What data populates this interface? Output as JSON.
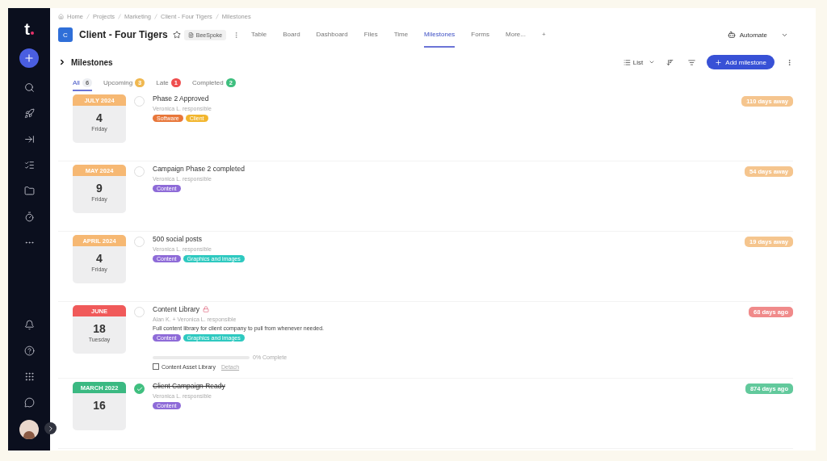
{
  "logo": "t",
  "breadcrumb": [
    "Home",
    "Projects",
    "Marketing",
    "Client - Four Tigers",
    "Milestones"
  ],
  "project": {
    "initial": "C",
    "title": "Client - Four Tigers",
    "starred": false,
    "tag": "BeeSpoke"
  },
  "view_tabs": [
    {
      "label": "Table",
      "selected": false
    },
    {
      "label": "Board",
      "selected": false
    },
    {
      "label": "Dashboard",
      "selected": false
    },
    {
      "label": "Files",
      "selected": false
    },
    {
      "label": "Time",
      "selected": false
    },
    {
      "label": "Milestones",
      "selected": true
    },
    {
      "label": "Forms",
      "selected": false
    },
    {
      "label": "More...",
      "selected": false
    }
  ],
  "add_tab": "+",
  "automate": "Automate",
  "section": {
    "title": "Milestones",
    "view": "List",
    "add_button": "Add milestone"
  },
  "filters": [
    {
      "label": "All",
      "count": "6",
      "kind": "all",
      "selected": true
    },
    {
      "label": "Upcoming",
      "count": "3",
      "kind": "upcoming",
      "selected": false
    },
    {
      "label": "Late",
      "count": "1",
      "kind": "late",
      "selected": false
    },
    {
      "label": "Completed",
      "count": "2",
      "kind": "done",
      "selected": false
    }
  ],
  "milestones": [
    {
      "kind": "upcoming",
      "month": "JULY 2024",
      "day": "4",
      "weekday": "Friday",
      "checked": false,
      "title": "Phase 2 Approved",
      "locked": false,
      "responsible": "Veronica L. responsible",
      "tags": [
        {
          "label": "Software",
          "color": "#e8773a"
        },
        {
          "label": "Client",
          "color": "#f2b62e"
        }
      ],
      "due": "110 days away"
    },
    {
      "kind": "upcoming",
      "month": "MAY 2024",
      "day": "9",
      "weekday": "Friday",
      "checked": false,
      "title": "Campaign Phase 2 completed",
      "locked": false,
      "responsible": "Veronica L. responsible",
      "tags": [
        {
          "label": "Content",
          "color": "#8e6bd8"
        }
      ],
      "due": "54 days away"
    },
    {
      "kind": "upcoming",
      "month": "APRIL 2024",
      "day": "4",
      "weekday": "Friday",
      "checked": false,
      "title": "500 social posts",
      "locked": false,
      "responsible": "Veronica L. responsible",
      "tags": [
        {
          "label": "Content",
          "color": "#8e6bd8"
        },
        {
          "label": "Graphics and images",
          "color": "#2ec9c0"
        }
      ],
      "due": "19 days away"
    },
    {
      "kind": "late",
      "month": "JUNE",
      "day": "18",
      "weekday": "Tuesday",
      "checked": false,
      "title": "Content Library",
      "locked": true,
      "responsible": "Alan K. + Veronica L. responsible",
      "description": "Full content library for client company to pull from whenever needed.",
      "tags": [
        {
          "label": "Content",
          "color": "#8e6bd8"
        },
        {
          "label": "Graphics and images",
          "color": "#2ec9c0"
        }
      ],
      "due": "68 days ago",
      "progress": {
        "level": 0,
        "reading": "0% Complete"
      },
      "subtask": {
        "label": "Content Asset Library",
        "checked": false,
        "link": "Detach"
      }
    },
    {
      "kind": "done",
      "month": "MARCH 2022",
      "day": "16",
      "checked": true,
      "title": "Client Campaign Ready",
      "locked": false,
      "responsible": "Veronica L. responsible",
      "tags": [
        {
          "label": "Content",
          "color": "#8e6bd8"
        }
      ],
      "due": "874 days ago"
    }
  ]
}
